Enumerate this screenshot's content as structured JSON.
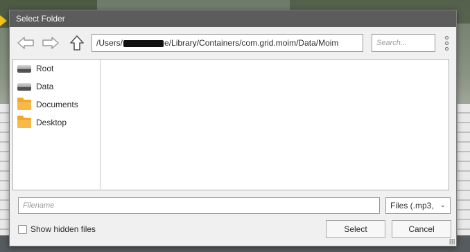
{
  "dialog": {
    "title": "Select Folder",
    "path_prefix": "/Users/",
    "path_suffix": "e/Library/Containers/com.grid.moim/Data/Moim",
    "search_placeholder": "Search...",
    "sidebar": {
      "items": [
        {
          "label": "Root",
          "icon": "drive-icon"
        },
        {
          "label": "Data",
          "icon": "drive-icon"
        },
        {
          "label": "Documents",
          "icon": "folder-icon"
        },
        {
          "label": "Desktop",
          "icon": "folder-icon"
        }
      ]
    },
    "filename_placeholder": "Filename",
    "filter_value": "Files (.mp3,",
    "show_hidden_label": "Show hidden files",
    "show_hidden_checked": false,
    "select_label": "Select",
    "cancel_label": "Cancel"
  },
  "colors": {
    "titlebar": "#5c5c5c",
    "folder": "#f5a623",
    "dialog_bg": "#f0f0f0"
  }
}
